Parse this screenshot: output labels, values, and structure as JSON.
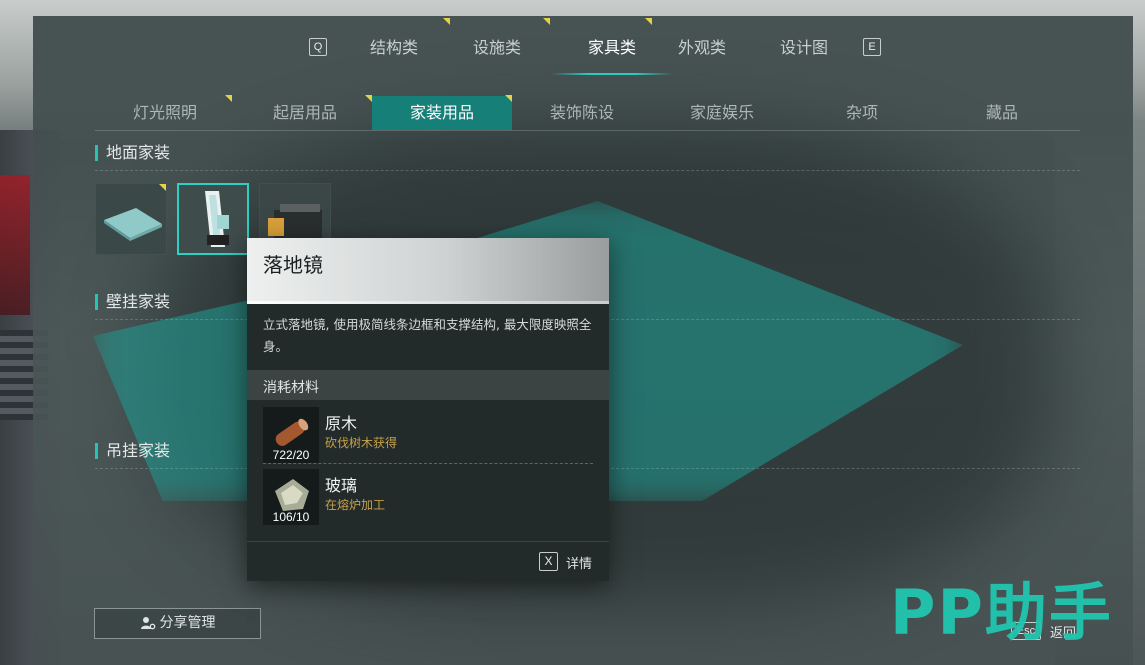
{
  "top_tabs": {
    "left_key": "Q",
    "right_key": "E",
    "items": [
      {
        "label": "结构类"
      },
      {
        "label": "设施类"
      },
      {
        "label": "家具类"
      },
      {
        "label": "外观类"
      },
      {
        "label": "设计图"
      }
    ],
    "active": "家具类"
  },
  "sub_tabs": {
    "items": [
      {
        "label": "灯光照明"
      },
      {
        "label": "起居用品"
      },
      {
        "label": "家装用品"
      },
      {
        "label": "装饰陈设"
      },
      {
        "label": "家庭娱乐"
      },
      {
        "label": "杂项"
      },
      {
        "label": "藏品"
      }
    ],
    "active": "家装用品"
  },
  "sections": {
    "floor": {
      "title": "地面家装"
    },
    "wall": {
      "title": "壁挂家装"
    },
    "hanging": {
      "title": "吊挂家装"
    }
  },
  "tooltip": {
    "title": "落地镜",
    "description": "立式落地镜, 使用极简线条边框和支撑结构, 最大限度映照全身。",
    "materials_title": "消耗材料",
    "materials": [
      {
        "name": "原木",
        "source": "砍伐树木获得",
        "count": "722/20",
        "icon": "log-icon"
      },
      {
        "name": "玻璃",
        "source": "在熔炉加工",
        "count": "106/10",
        "icon": "glass-icon"
      }
    ],
    "detail_key": "X",
    "detail_label": "详情"
  },
  "footer": {
    "share_label": "分享管理",
    "esc_key": "Esc",
    "back_label": "返回"
  },
  "watermark": {
    "text": "PP助手"
  },
  "colors": {
    "accent": "#2cc9bd",
    "active_subtab": "#157f78",
    "new_flag": "#e6d24a",
    "material_source": "#c7a34a",
    "watermark": "#21c6b0"
  }
}
